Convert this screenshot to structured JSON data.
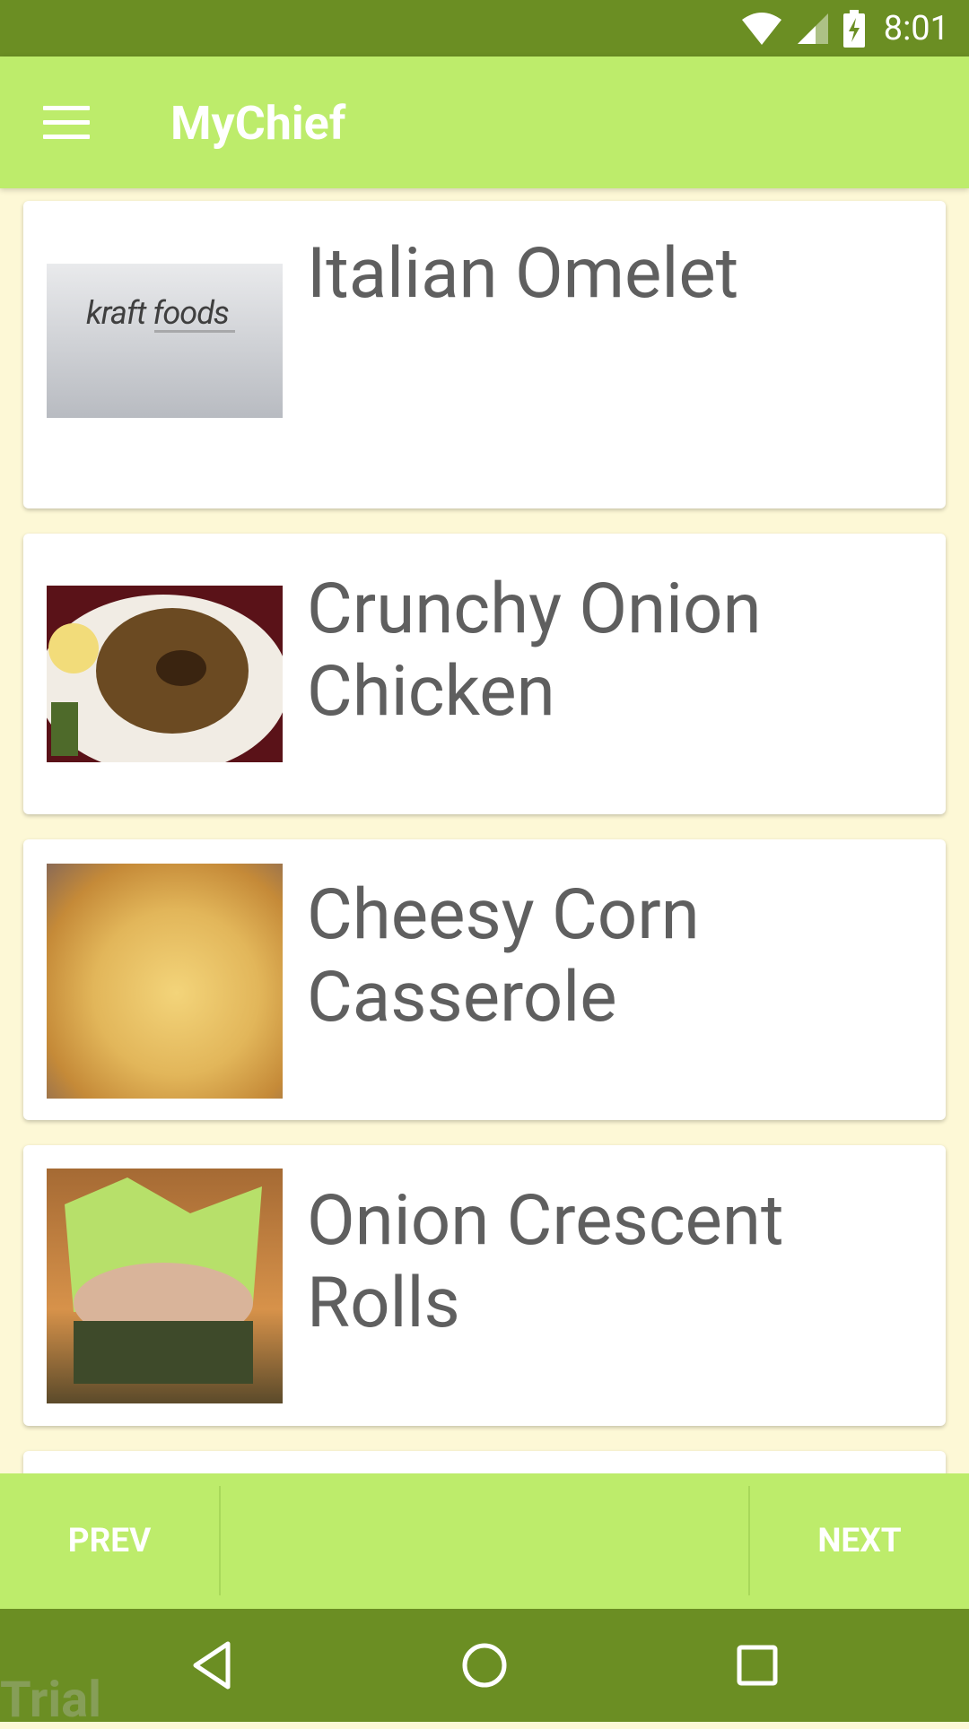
{
  "status_bar": {
    "time": "8:01"
  },
  "app_bar": {
    "title": "MyChief"
  },
  "recipes": [
    {
      "title": "Italian Omelet",
      "thumb_text": "kraft foods"
    },
    {
      "title": "Crunchy Onion Chicken"
    },
    {
      "title": "Cheesy Corn Casserole"
    },
    {
      "title": "Onion Crescent Rolls"
    }
  ],
  "pager": {
    "prev_label": "PREV",
    "next_label": "NEXT"
  },
  "watermark": "Trial",
  "colors": {
    "status_bar": "#6b8e23",
    "app_bar": "#bdec6b",
    "background": "#fdf8d6",
    "title_text": "#5f5f5f"
  }
}
